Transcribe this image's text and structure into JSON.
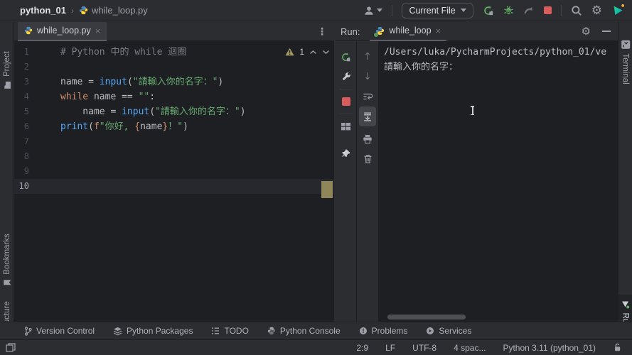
{
  "titlebar": {
    "breadcrumb_project": "python_01",
    "breadcrumb_sep": "›",
    "breadcrumb_file": "while_loop.py",
    "run_config_selector": "Current File",
    "icons": [
      "user-icon",
      "rerun-icon",
      "debug-icon",
      "profiler-icon",
      "stop-icon",
      "search-icon",
      "settings-gear-icon",
      "pycharm-logo-icon"
    ]
  },
  "editor": {
    "tab_label": "while_loop.py",
    "tab_close": "×",
    "kebab": "⋮",
    "warning_count": "1",
    "lines": [
      {
        "num": "1",
        "current": false,
        "tokens": [
          {
            "c": "comment",
            "t": "# Python 中的 while 迴圈"
          }
        ]
      },
      {
        "num": "2",
        "current": false,
        "tokens": []
      },
      {
        "num": "3",
        "current": false,
        "tokens": [
          {
            "c": "plain",
            "t": "name "
          },
          {
            "c": "plain",
            "t": "= "
          },
          {
            "c": "func",
            "t": "input"
          },
          {
            "c": "plain",
            "t": "("
          },
          {
            "c": "str",
            "t": "\"請輸入你的名字：\""
          },
          {
            "c": "plain",
            "t": ")"
          }
        ]
      },
      {
        "num": "4",
        "current": false,
        "tokens": [
          {
            "c": "kw",
            "t": "while "
          },
          {
            "c": "plain",
            "t": "name "
          },
          {
            "c": "plain",
            "t": "== "
          },
          {
            "c": "str",
            "t": "\"\""
          },
          {
            "c": "plain",
            "t": ":"
          }
        ]
      },
      {
        "num": "5",
        "current": false,
        "tokens": [
          {
            "c": "plain",
            "t": "    name "
          },
          {
            "c": "plain",
            "t": "= "
          },
          {
            "c": "func",
            "t": "input"
          },
          {
            "c": "plain",
            "t": "("
          },
          {
            "c": "str",
            "t": "\"請輸入你的名字：\""
          },
          {
            "c": "plain",
            "t": ")"
          }
        ]
      },
      {
        "num": "6",
        "current": false,
        "tokens": [
          {
            "c": "func",
            "t": "print"
          },
          {
            "c": "plain",
            "t": "("
          },
          {
            "c": "kw",
            "t": "f"
          },
          {
            "c": "str",
            "t": "\"你好, "
          },
          {
            "c": "brace",
            "t": "{"
          },
          {
            "c": "plain",
            "t": "name"
          },
          {
            "c": "brace",
            "t": "}"
          },
          {
            "c": "str",
            "t": "！\""
          },
          {
            "c": "plain",
            "t": ")"
          }
        ]
      },
      {
        "num": "7",
        "current": false,
        "tokens": []
      },
      {
        "num": "8",
        "current": false,
        "tokens": []
      },
      {
        "num": "9",
        "current": false,
        "tokens": []
      },
      {
        "num": "10",
        "current": true,
        "tokens": []
      }
    ]
  },
  "run_panel": {
    "label": "Run:",
    "tab_label": "while_loop",
    "tab_close": "×",
    "console_lines": [
      "/Users/luka/PycharmProjects/python_01/ve",
      "請輸入你的名字："
    ],
    "left_toolbar_icons": [
      "rerun-icon",
      "wrench-icon",
      "stop-icon",
      "layout-icon",
      "pin-icon"
    ],
    "right_toolbar_icons": [
      "up-arrow-icon",
      "down-arrow-icon",
      "softwrap-icon",
      "scroll-to-end-icon",
      "printer-icon",
      "trash-icon"
    ],
    "up_glyph": "↑",
    "down_glyph": "↓"
  },
  "stripes": {
    "left": [
      {
        "label": "Project",
        "icon": "folder-icon"
      },
      {
        "label": "Bookmarks",
        "icon": "bookmark-icon"
      },
      {
        "label": "Structure",
        "icon": "structure-icon"
      }
    ],
    "right": [
      {
        "label": "Terminal",
        "icon": "terminal-icon"
      },
      {
        "label": "Run",
        "icon": "run-play-icon"
      }
    ]
  },
  "bottom_toolbar": {
    "items": [
      {
        "label": "Version Control",
        "icon": "branch-icon"
      },
      {
        "label": "Python Packages",
        "icon": "packages-icon"
      },
      {
        "label": "TODO",
        "icon": "todo-list-icon"
      },
      {
        "label": "Python Console",
        "icon": "python-icon"
      },
      {
        "label": "Problems",
        "icon": "problems-icon"
      },
      {
        "label": "Services",
        "icon": "services-icon"
      }
    ]
  },
  "statusbar": {
    "cursor_position": "2:9",
    "line_separator": "LF",
    "encoding": "UTF-8",
    "indent": "4 spac...",
    "interpreter": "Python 3.11 (python_01)"
  },
  "colors": {
    "panel_bg": "#2B2D30",
    "editor_bg": "#1E1F22",
    "keyword": "#CF8E6D",
    "function": "#56A8F5",
    "string": "#6AAB73",
    "comment": "#7A7E85",
    "run_green": "#5FAD65",
    "stop_red": "#DB5C5C",
    "warning_tan": "#A49B63",
    "scroll_marker": "#8F8759",
    "current_line": "#26282E"
  }
}
